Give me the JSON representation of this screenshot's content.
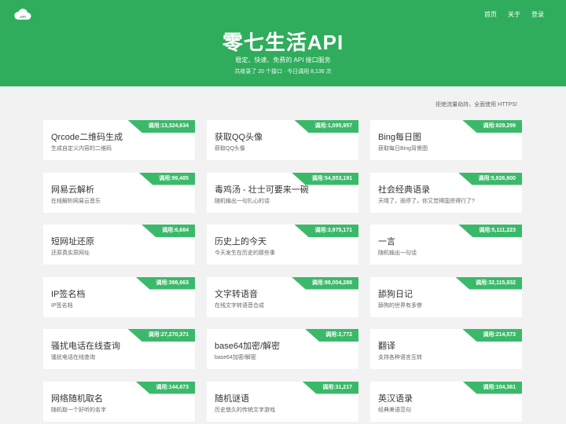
{
  "header": {
    "nav": [
      "首页",
      "关于",
      "登录"
    ],
    "title": "零七生活API",
    "subtitle": "稳定、快速、免费的 API 接口服务",
    "stats": "共收录了 20 个接口 · 今日调用 8,136 次"
  },
  "notice": "拒绝流量劫持，全面使用 HTTPS!",
  "apis": [
    {
      "title": "Qrcode二维码生成",
      "desc": "生成自定义内容的二维码",
      "calls": "调用:13,324,634"
    },
    {
      "title": "获取QQ头像",
      "desc": "获取QQ头像",
      "calls": "调用:1,095,957"
    },
    {
      "title": "Bing每日图",
      "desc": "获取每日Bing背景图",
      "calls": "调用:829,299"
    },
    {
      "title": "网易云解析",
      "desc": "在线解析网易云音乐",
      "calls": "调用:99,485"
    },
    {
      "title": "毒鸡汤 - 壮士可要来一碗",
      "desc": "随机输出一句扎心的话",
      "calls": "调用:54,853,191"
    },
    {
      "title": "社会经典语录",
      "desc": "天晴了，雨停了，你又觉得国资得行了?",
      "calls": "调用:5,926,900"
    },
    {
      "title": "短网址还原",
      "desc": "还原真实原网址",
      "calls": "调用:6,684"
    },
    {
      "title": "历史上的今天",
      "desc": "今天发生在历史的那些事",
      "calls": "调用:3,975,171"
    },
    {
      "title": "一言",
      "desc": "随机输出一句话",
      "calls": "调用:5,111,223"
    },
    {
      "title": "IP签名档",
      "desc": "IP签名档",
      "calls": "调用:398,663"
    },
    {
      "title": "文字转语音",
      "desc": "在线文字转语音合成",
      "calls": "调用:88,004,288"
    },
    {
      "title": "舔狗日记",
      "desc": "舔狗的世界有多惨",
      "calls": "调用:32,115,832"
    },
    {
      "title": "骚扰电话在线查询",
      "desc": "骚扰电话在线查询",
      "calls": "调用:27,270,371"
    },
    {
      "title": "base64加密/解密",
      "desc": "base64加密/解密",
      "calls": "调用:2,772"
    },
    {
      "title": "翻译",
      "desc": "支持各种语言互转",
      "calls": "调用:214,573"
    },
    {
      "title": "网络随机取名",
      "desc": "随机取一个好听的名字",
      "calls": "调用:144,673"
    },
    {
      "title": "随机谜语",
      "desc": "历史悠久的传统文字游戏",
      "calls": "调用:31,217"
    },
    {
      "title": "英汉语录",
      "desc": "经典美语范句",
      "calls": "调用:104,361"
    }
  ]
}
